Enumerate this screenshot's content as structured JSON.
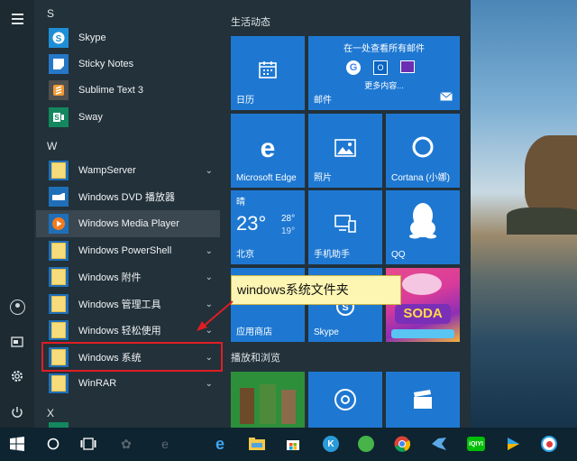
{
  "app_list": {
    "letters": {
      "s": "S",
      "w": "W",
      "x": "X"
    },
    "items": [
      {
        "label": "Skype",
        "icon": "skype-icon",
        "color": "#1e8fd6"
      },
      {
        "label": "Sticky Notes",
        "icon": "sticky-notes-icon",
        "color": "#2677c7"
      },
      {
        "label": "Sublime Text 3",
        "icon": "sublime-text-icon",
        "color": "#505050"
      },
      {
        "label": "Sway",
        "icon": "sway-icon",
        "color": "#14875e"
      },
      {
        "label": "WampServer",
        "icon": "folder-icon",
        "color": "#1f6fb8"
      },
      {
        "label": "Windows DVD 播放器",
        "icon": "dvd-player-icon",
        "color": "#1f6fb8"
      },
      {
        "label": "Windows Media Player",
        "icon": "media-player-icon",
        "color": "#1f6fb8"
      },
      {
        "label": "Windows PowerShell",
        "icon": "folder-icon",
        "color": "#1f6fb8"
      },
      {
        "label": "Windows 附件",
        "icon": "folder-icon",
        "color": "#1f6fb8"
      },
      {
        "label": "Windows 管理工具",
        "icon": "folder-icon",
        "color": "#1f6fb8"
      },
      {
        "label": "Windows 轻松使用",
        "icon": "folder-icon",
        "color": "#1f6fb8"
      },
      {
        "label": "Windows 系统",
        "icon": "folder-icon",
        "color": "#1f6fb8"
      },
      {
        "label": "WinRAR",
        "icon": "folder-icon",
        "color": "#1f6fb8"
      }
    ]
  },
  "tiles": {
    "group1_title": "生活动态",
    "group2_title": "播放和浏览",
    "calendar": "日历",
    "mail_header": "在一处查看所有邮件",
    "mail_more": "更多内容...",
    "mail": "邮件",
    "edge": "Microsoft Edge",
    "photos": "照片",
    "cortana": "Cortana (小娜)",
    "weather_condition": "晴",
    "weather_temp": "23°",
    "weather_high": "28°",
    "weather_low": "19°",
    "weather_city": "北京",
    "phone": "手机助手",
    "qq": "QQ",
    "store": "应用商店",
    "skype": "Skype"
  },
  "callout": {
    "text": "windows系统文件夹"
  },
  "colors": {
    "tile_blue": "#1e78d2",
    "highlight_red": "#e01d24",
    "callout_bg": "#fdf6b3"
  }
}
